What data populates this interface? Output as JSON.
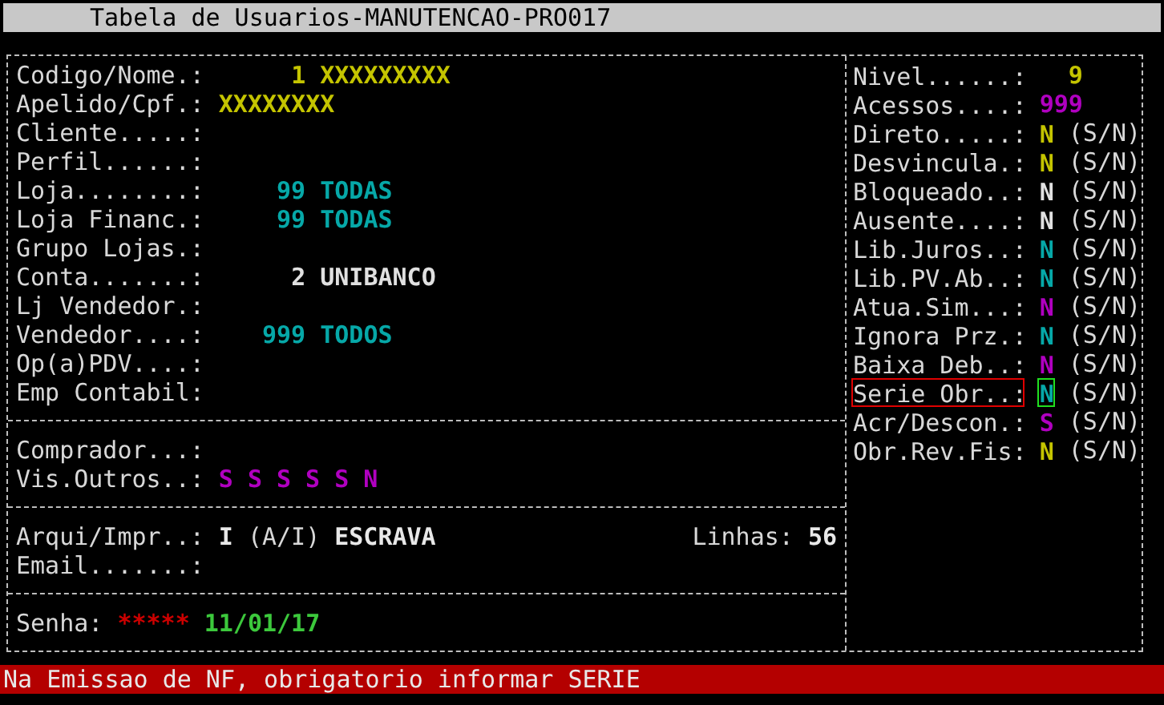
{
  "window": {
    "title": "Tabela de Usuarios-MANUTENCAO-PRO017"
  },
  "fields": [
    {
      "label": "Codigo/Nome.:",
      "code": "1",
      "name": "XXXXXXXXX",
      "color": "#c4c400"
    },
    {
      "label": "Apelido/Cpf.:",
      "name": "XXXXXXXX",
      "color": "#c4c400"
    },
    {
      "label": "Cliente.....:"
    },
    {
      "label": "Perfil......:"
    },
    {
      "label": "Loja........:",
      "code": "99",
      "name": "TODAS",
      "color": "#06a8a8"
    },
    {
      "label": "Loja Financ.:",
      "code": "99",
      "name": "TODAS",
      "color": "#06a8a8"
    },
    {
      "label": "Grupo Lojas.:"
    },
    {
      "label": "Conta.......:",
      "code": "2",
      "name": "UNIBANCO",
      "color": "#e0e0e0"
    },
    {
      "label": "Lj Vendedor.:"
    },
    {
      "label": "Vendedor....:",
      "code": "999",
      "name": "TODOS",
      "color": "#06a8a8"
    },
    {
      "label": "Op(a)PDV....:"
    },
    {
      "label": "Emp Contabil:"
    }
  ],
  "buyer": {
    "label": "Comprador...:"
  },
  "vis_outros": {
    "label": "Vis.Outros..:",
    "flags": [
      {
        "text": "S",
        "color": "#b000c0"
      },
      {
        "text": "S",
        "color": "#b000c0"
      },
      {
        "text": "S",
        "color": "#b000c0"
      },
      {
        "text": "S",
        "color": "#b000c0"
      },
      {
        "text": "S",
        "color": "#b000c0"
      },
      {
        "text": "N",
        "color": "#b000c0"
      }
    ]
  },
  "output": {
    "label": "Arqui/Impr..:",
    "value": "I",
    "hint": "(A/I)",
    "name": "ESCRAVA",
    "lines_label": "Linhas:",
    "lines": "56"
  },
  "email": {
    "label": "Email.......:"
  },
  "password": {
    "label": "Senha:",
    "value": "*****",
    "date": "11/01/17"
  },
  "flags_panel": [
    {
      "kind": "number",
      "label": "Nivel......:",
      "value": "9",
      "color": "#c4c400",
      "focused": false
    },
    {
      "kind": "number",
      "label": "Acessos....:",
      "value": "999",
      "color": "#b000c0",
      "focused": false
    },
    {
      "kind": "flag",
      "label": "Direto.....:",
      "value": "N",
      "hint": "(S/N)",
      "color": "#c4c400",
      "focused": false
    },
    {
      "kind": "flag",
      "label": "Desvincula.:",
      "value": "N",
      "hint": "(S/N)",
      "color": "#c4c400",
      "focused": false
    },
    {
      "kind": "flag",
      "label": "Bloqueado..:",
      "value": "N",
      "hint": "(S/N)",
      "color": "#e0e0e0",
      "focused": false
    },
    {
      "kind": "flag",
      "label": "Ausente....:",
      "value": "N",
      "hint": "(S/N)",
      "color": "#e0e0e0",
      "focused": false
    },
    {
      "kind": "flag",
      "label": "Lib.Juros..:",
      "value": "N",
      "hint": "(S/N)",
      "color": "#06a8a8",
      "focused": false
    },
    {
      "kind": "flag",
      "label": "Lib.PV.Ab..:",
      "value": "N",
      "hint": "(S/N)",
      "color": "#06a8a8",
      "focused": false
    },
    {
      "kind": "flag",
      "label": "Atua.Sim...:",
      "value": "N",
      "hint": "(S/N)",
      "color": "#b000c0",
      "focused": false
    },
    {
      "kind": "flag",
      "label": "Ignora Prz.:",
      "value": "N",
      "hint": "(S/N)",
      "color": "#06a8a8",
      "focused": false
    },
    {
      "kind": "flag",
      "label": "Baixa Deb..:",
      "value": "N",
      "hint": "(S/N)",
      "color": "#b000c0",
      "focused": false
    },
    {
      "kind": "flag",
      "label": "Serie Obr..:",
      "value": "N",
      "hint": "(S/N)",
      "color": "#06a8a8",
      "focused": true
    },
    {
      "kind": "flag",
      "label": "Acr/Descon.:",
      "value": "S",
      "hint": "(S/N)",
      "color": "#b000c0",
      "focused": false
    },
    {
      "kind": "flag",
      "label": "Obr.Rev.Fis:",
      "value": "N",
      "hint": "(S/N)",
      "color": "#c4c400",
      "focused": false
    }
  ],
  "status_bar": {
    "message": "Na Emissao de NF, obrigatorio informar SERIE"
  }
}
